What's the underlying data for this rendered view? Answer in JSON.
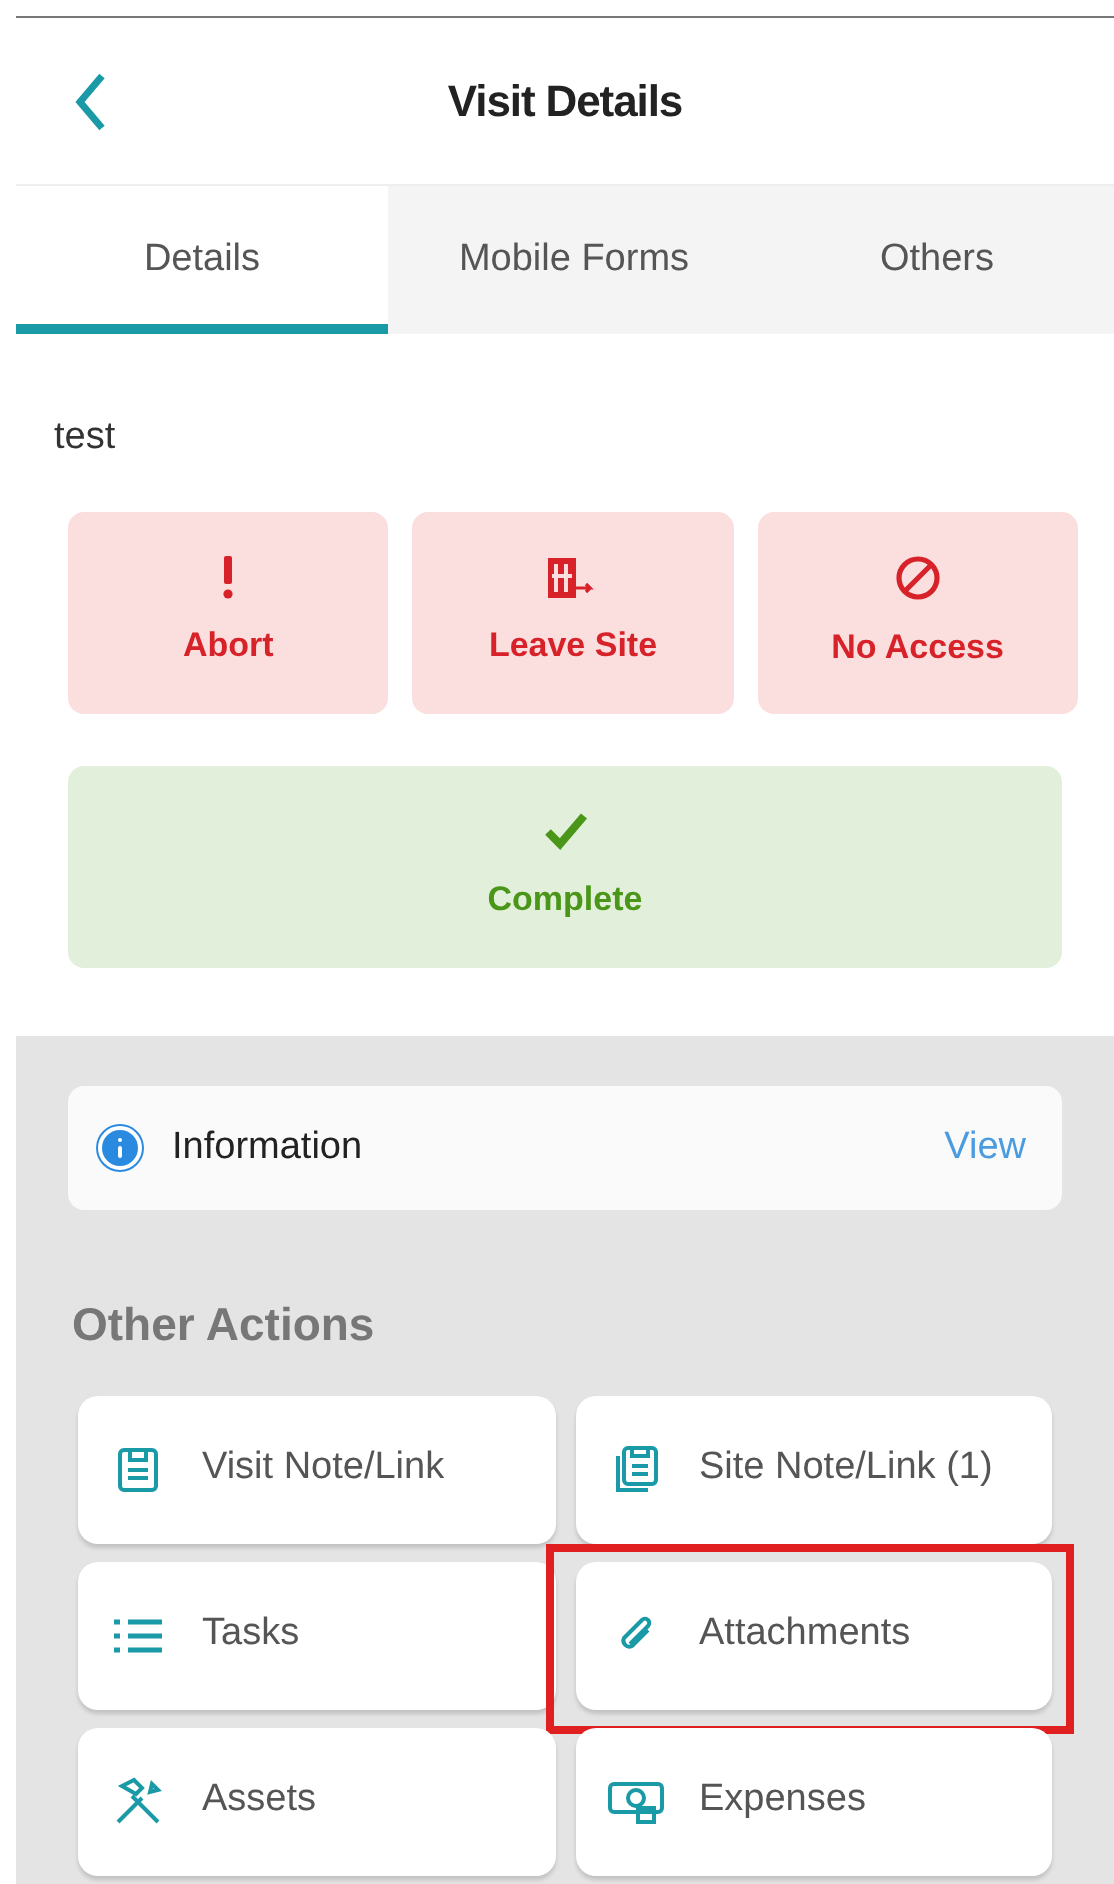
{
  "header": {
    "title": "Visit Details"
  },
  "tabs": [
    {
      "label": "Details",
      "selected": true
    },
    {
      "label": "Mobile Forms",
      "selected": false
    },
    {
      "label": "Others",
      "selected": false
    }
  ],
  "site_name": "test",
  "status_actions": [
    {
      "label": "Abort",
      "kind": "danger"
    },
    {
      "label": "Leave Site",
      "kind": "danger"
    },
    {
      "label": "No Access",
      "kind": "danger"
    }
  ],
  "complete_action": {
    "label": "Complete",
    "kind": "success"
  },
  "information": {
    "label": "Information",
    "link": "View"
  },
  "other_actions": {
    "title": "Other Actions",
    "items": [
      {
        "label": "Visit Note/Link",
        "highlighted": false
      },
      {
        "label": "Site Note/Link (1)",
        "highlighted": false
      },
      {
        "label": "Tasks",
        "highlighted": false
      },
      {
        "label": "Attachments",
        "highlighted": true
      },
      {
        "label": "Assets",
        "highlighted": false
      },
      {
        "label": "Expenses",
        "highlighted": false
      }
    ]
  }
}
